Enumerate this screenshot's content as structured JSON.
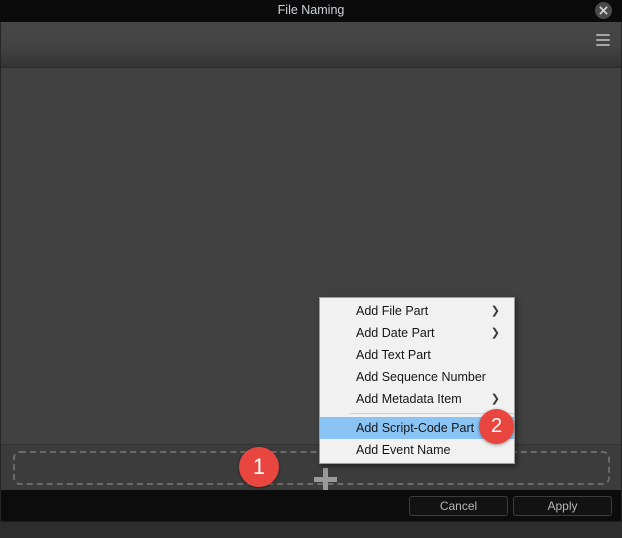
{
  "window": {
    "title": "File Naming",
    "close_icon": "close-circle-icon"
  },
  "toolbar": {
    "menu_icon": "hamburger-menu-icon"
  },
  "drop_zone": {
    "add_icon": "plus-icon"
  },
  "footer": {
    "cancel_label": "Cancel",
    "apply_label": "Apply"
  },
  "context_menu": {
    "items": [
      {
        "label": "Add File Part",
        "has_submenu": true,
        "submenu_icon": "chevron-right-icon",
        "selected": false,
        "separator_above": false
      },
      {
        "label": "Add Date Part",
        "has_submenu": true,
        "submenu_icon": "chevron-right-icon",
        "selected": false,
        "separator_above": false
      },
      {
        "label": "Add Text Part",
        "has_submenu": false,
        "submenu_icon": "",
        "selected": false,
        "separator_above": false
      },
      {
        "label": "Add Sequence Number",
        "has_submenu": false,
        "submenu_icon": "",
        "selected": false,
        "separator_above": false
      },
      {
        "label": "Add Metadata Item",
        "has_submenu": true,
        "submenu_icon": "chevron-right-icon",
        "selected": false,
        "separator_above": false
      },
      {
        "label": "Add Script-Code Part",
        "has_submenu": false,
        "submenu_icon": "",
        "selected": true,
        "separator_above": true
      },
      {
        "label": "Add Event Name",
        "has_submenu": false,
        "submenu_icon": "",
        "selected": false,
        "separator_above": false
      }
    ]
  },
  "step_badges": [
    {
      "number": "1"
    },
    {
      "number": "2"
    }
  ],
  "colors": {
    "badge": "#e8463f",
    "menu_highlight": "#89c4f4",
    "menu_background": "#f1f1f1",
    "dialog_background": "#414141",
    "titlebar_background": "#0b0b0b"
  }
}
